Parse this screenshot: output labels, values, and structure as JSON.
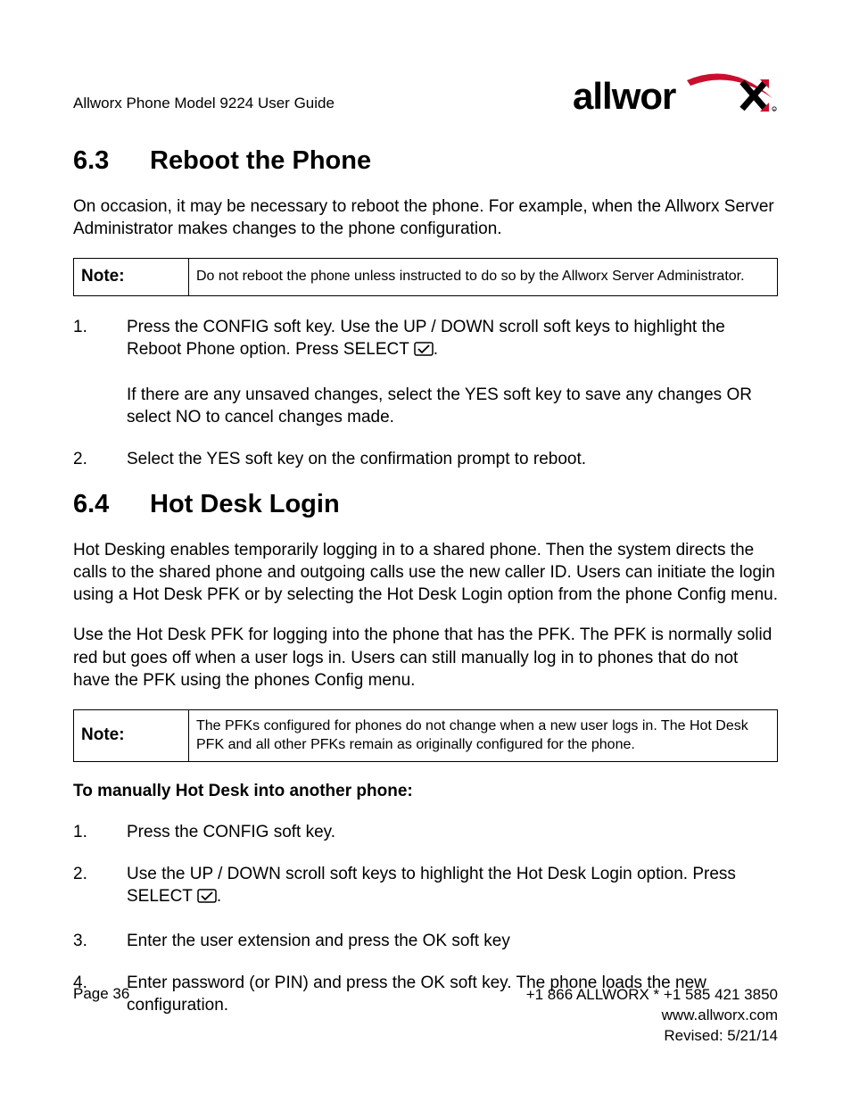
{
  "header": {
    "doc_title": "Allworx Phone Model 9224 User Guide",
    "logo_name": "allworx"
  },
  "section63": {
    "num": "6.3",
    "title": "Reboot the Phone",
    "intro": "On occasion, it may be necessary to reboot the phone. For example, when the Allworx Server Administrator makes changes to the phone configuration.",
    "note_label": "Note:",
    "note_text": "Do not reboot the phone unless instructed to do so by the Allworx Server Administrator.",
    "step1_a": "Press the CONFIG soft key. Use the UP / DOWN scroll soft keys to highlight the Reboot Phone option. Press SELECT ",
    "step1_b": ".",
    "step1_extra": "If there are any unsaved changes, select the YES soft key to save any changes OR select NO to cancel changes made.",
    "step2": "Select the YES soft key on the confirmation prompt to reboot."
  },
  "section64": {
    "num": "6.4",
    "title": "Hot Desk Login",
    "para1": "Hot Desking enables temporarily logging in to a shared phone. Then the system directs the calls to the shared phone and outgoing calls use the new caller ID. Users can initiate the login using a Hot Desk PFK or by selecting the Hot Desk Login option from the phone Config menu.",
    "para2": "Use the Hot Desk PFK for logging into the phone that has the PFK. The PFK is normally solid red but goes off when a user logs in. Users can still manually log in to phones that do not have the PFK using the phones Config menu.",
    "note_label": "Note:",
    "note_text": "The PFKs configured for phones do not change when a new user logs in. The Hot Desk PFK and all other PFKs remain as originally configured for the phone.",
    "subhead": "To manually Hot Desk into another phone:",
    "step1": "Press the CONFIG soft key.",
    "step2_a": "Use the UP / DOWN scroll soft keys to highlight the Hot Desk Login option. Press SELECT ",
    "step2_b": ".",
    "step3": "Enter the user extension and press the OK soft key",
    "step4": "Enter password (or PIN) and press the OK soft key. The phone loads the new configuration."
  },
  "footer": {
    "page": "Page 36",
    "phone": "+1 866 ALLWORX * +1 585 421 3850",
    "url": "www.allworx.com",
    "revised": "Revised: 5/21/14"
  }
}
